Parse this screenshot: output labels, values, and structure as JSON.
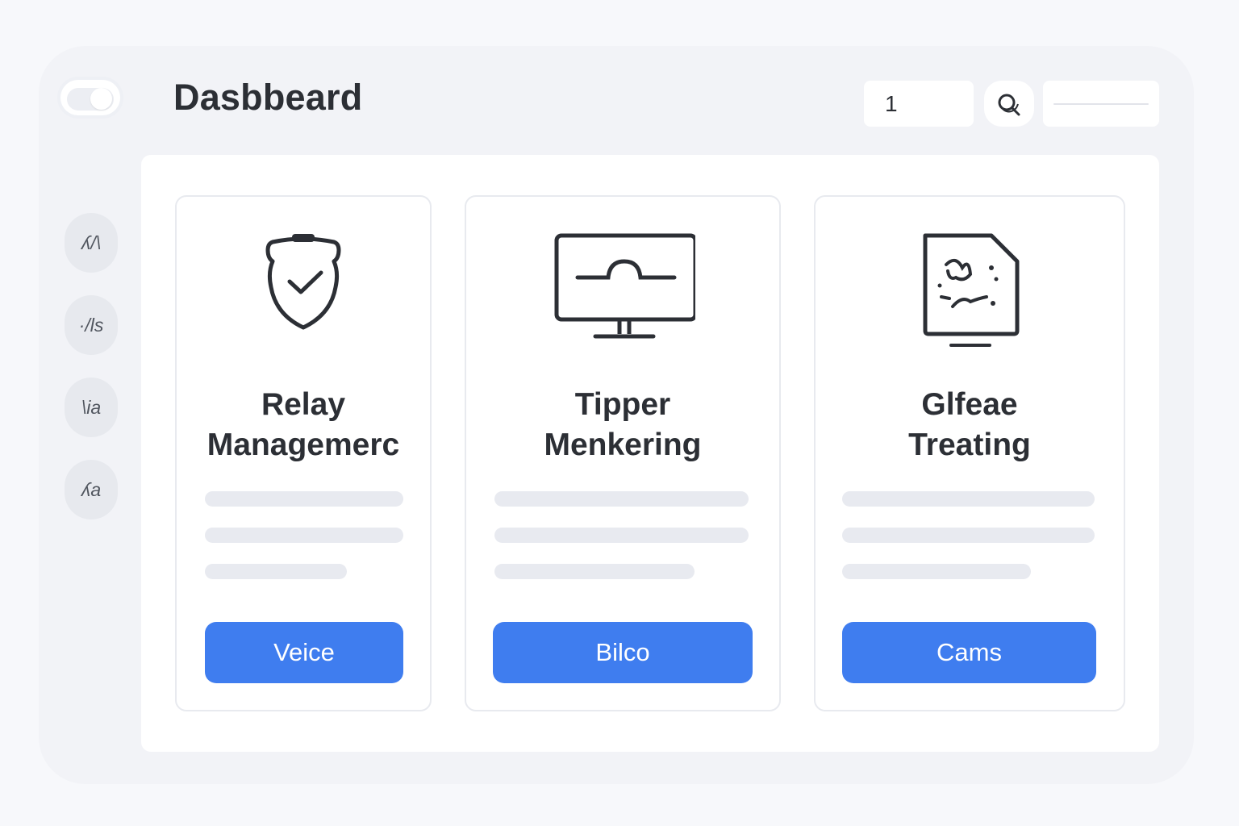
{
  "header": {
    "title": "Dasbbeard",
    "input_value": "1"
  },
  "sidebar": {
    "items": [
      {
        "label": "ʎ/\\",
        "icon": "code-icon"
      },
      {
        "label": "·/ls",
        "icon": "list-icon"
      },
      {
        "label": "\\ia",
        "icon": "text-icon"
      },
      {
        "label": "ʎa",
        "icon": "translate-icon"
      }
    ]
  },
  "cards": [
    {
      "title_line1": "Relay",
      "title_line2": "Managemerc",
      "button_label": "Veice",
      "icon": "shield-check-icon"
    },
    {
      "title_line1": "Tipper",
      "title_line2": "Menkering",
      "button_label": "Bilco",
      "icon": "monitor-icon"
    },
    {
      "title_line1": "Glfeae",
      "title_line2": "Treating",
      "button_label": "Cams",
      "icon": "document-icon"
    }
  ],
  "colors": {
    "accent": "#3f7def",
    "background": "#f2f3f7",
    "panel": "#ffffff",
    "text": "#2c2f35"
  }
}
